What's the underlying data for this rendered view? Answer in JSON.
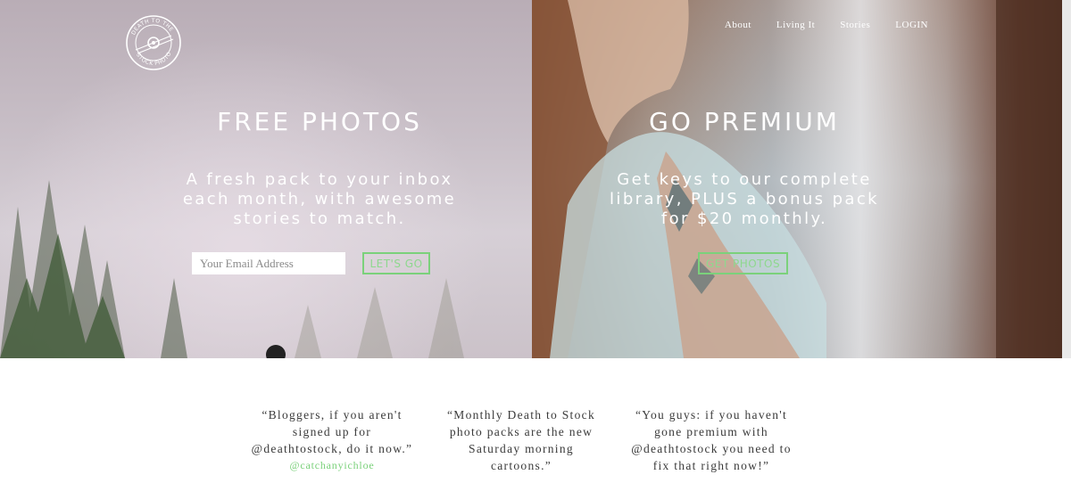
{
  "nav": {
    "items": [
      "About",
      "Living It",
      "Stories",
      "LOGIN"
    ]
  },
  "logo": {
    "text_top": "DEATH TO THE",
    "text_bottom": "STOCK PHOTO"
  },
  "free": {
    "title": "FREE PHOTOS",
    "description": "A fresh pack to your inbox each month, with awesome stories to match.",
    "email_placeholder": "Your Email Address",
    "button_label": "LET'S GO"
  },
  "premium": {
    "title": "GO PREMIUM",
    "description": "Get keys to our complete library, PLUS a bonus pack for $20 monthly.",
    "button_label": "GET PHOTOS"
  },
  "testimonials": [
    {
      "text": "“Bloggers, if you aren't signed up for @deathtostock, do it now.”",
      "author": "@catchanyichloe"
    },
    {
      "text": "“Monthly Death to Stock photo packs are the new Saturday morning cartoons.”",
      "author": ""
    },
    {
      "text": "“You guys: if you haven't gone premium with @deathtostock you need to fix that right now!”",
      "author": ""
    }
  ],
  "colors": {
    "accent": "#7bd17b",
    "text_dark": "#3a3a3a"
  }
}
